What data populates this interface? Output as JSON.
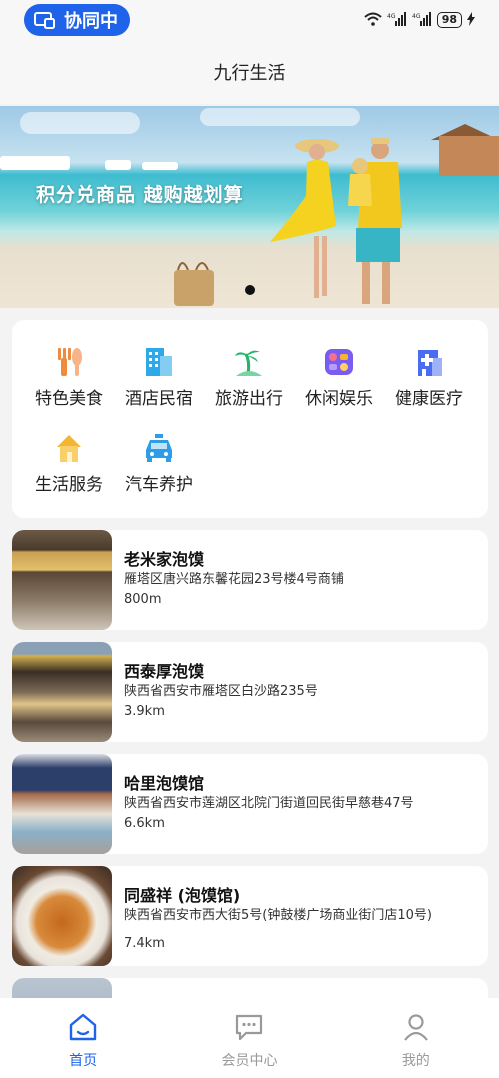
{
  "status_bar": {
    "collab_label": "协同中",
    "battery": "98",
    "signal_1": "4G",
    "signal_2": "4G"
  },
  "header": {
    "title": "九行生活"
  },
  "banner": {
    "slogan": "积分兑商品 越购越划算",
    "active_slide": 1
  },
  "categories": [
    {
      "label": "特色美食",
      "icon": "food-icon",
      "color": "#f08a3c"
    },
    {
      "label": "酒店民宿",
      "icon": "hotel-icon",
      "color": "#2fa8e8"
    },
    {
      "label": "旅游出行",
      "icon": "travel-icon",
      "color": "#25b36b"
    },
    {
      "label": "休闲娱乐",
      "icon": "entertainment-icon",
      "color": "#7a5cf0"
    },
    {
      "label": "健康医疗",
      "icon": "medical-icon",
      "color": "#4a6cf0"
    },
    {
      "label": "生活服务",
      "icon": "home-service-icon",
      "color": "#f4b630"
    },
    {
      "label": "汽车养护",
      "icon": "car-care-icon",
      "color": "#2f9ce8"
    }
  ],
  "shops": [
    {
      "name": "老米家泡馍",
      "address": "雁塔区唐兴路东馨花园23号楼4号商铺",
      "distance": "800m"
    },
    {
      "name": "西泰厚泡馍",
      "address": "陕西省西安市雁塔区白沙路235号",
      "distance": "3.9km"
    },
    {
      "name": "哈里泡馍馆",
      "address": "陕西省西安市莲湖区北院门街道回民街早慈巷47号",
      "distance": "6.6km"
    },
    {
      "name": "同盛祥 (泡馍馆)",
      "address": "陕西省西安市西大街5号(钟鼓楼广场商业街门店10号)",
      "distance": "7.4km"
    }
  ],
  "bottom_nav": [
    {
      "label": "首页",
      "icon": "home-icon",
      "active": true
    },
    {
      "label": "会员中心",
      "icon": "chat-icon",
      "active": false
    },
    {
      "label": "我的",
      "icon": "user-icon",
      "active": false
    }
  ],
  "colors": {
    "accent": "#1e63e9",
    "inactive": "#999999"
  }
}
